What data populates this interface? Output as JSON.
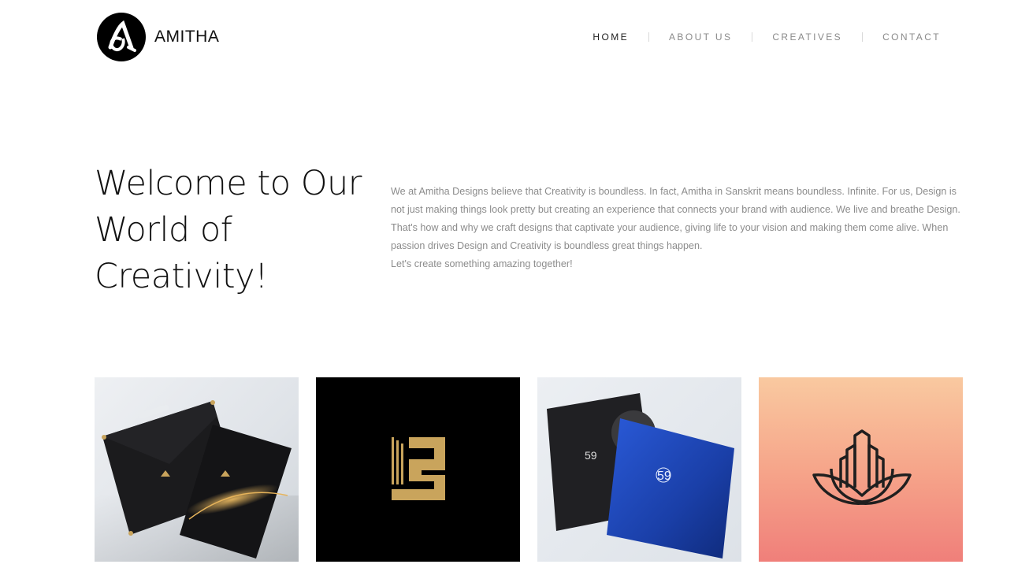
{
  "brand": {
    "name": "AMITHA"
  },
  "nav": {
    "items": [
      {
        "label": "HOME"
      },
      {
        "label": "ABOUT US"
      },
      {
        "label": "CREATIVES"
      },
      {
        "label": "CONTACT"
      }
    ],
    "active": "HOME"
  },
  "intro": {
    "headline": "Welcome to Our World of Creativity!",
    "paragraph": "We at Amitha Designs believe that Creativity is boundless. In fact, Amitha in Sanskrit means boundless. Infinite. For us, Design is not just making things look pretty but creating an experience that connects your brand with audience. We live and breathe Design. That's how and why we craft designs that captivate your audience, giving life to your vision and making them come alive. When passion drives Design and Creativity is boundless great things happen.",
    "cta_line": "Let's create something amazing together!"
  },
  "gallery": {
    "tiles": [
      {
        "icon": "stationery-mockup-image"
      },
      {
        "icon": "gold-monogram-logo-image"
      },
      {
        "icon": "anniversary-book-mockup-image"
      },
      {
        "icon": "lotus-city-logo-image"
      }
    ]
  },
  "colors": {
    "nav_active": "#222222",
    "nav_inactive": "#8a8a8a",
    "body_text": "#8c8c8c",
    "gold": "#c9a45c",
    "lotus_gradient_top": "#f9c9a0",
    "lotus_gradient_bottom": "#f07f7a"
  }
}
